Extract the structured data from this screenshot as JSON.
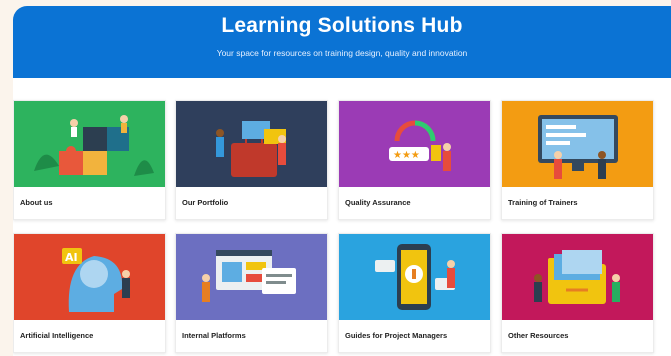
{
  "header": {
    "title": "Learning Solutions Hub",
    "subtitle": "Your space for resources on training design, quality and innovation"
  },
  "cards": [
    {
      "label": "About us",
      "icon": "puzzle-team-illustration",
      "color": "#27ae60"
    },
    {
      "label": "Our Portfolio",
      "icon": "portfolio-briefcase-illustration",
      "color": "#2f3f5c"
    },
    {
      "label": "Quality Assurance",
      "icon": "quality-rating-illustration",
      "color": "#8e44ad"
    },
    {
      "label": "Training of Trainers",
      "icon": "trainer-screen-illustration",
      "color": "#f39c12"
    },
    {
      "label": "Artificial Intelligence",
      "icon": "ai-brain-illustration",
      "color": "#e0452b"
    },
    {
      "label": "Internal Platforms",
      "icon": "platform-windows-illustration",
      "color": "#6c6fc1"
    },
    {
      "label": "Guides for Project Managers",
      "icon": "phone-guide-illustration",
      "color": "#2aa3df"
    },
    {
      "label": "Other Resources",
      "icon": "resources-folder-illustration",
      "color": "#c2185b"
    }
  ]
}
